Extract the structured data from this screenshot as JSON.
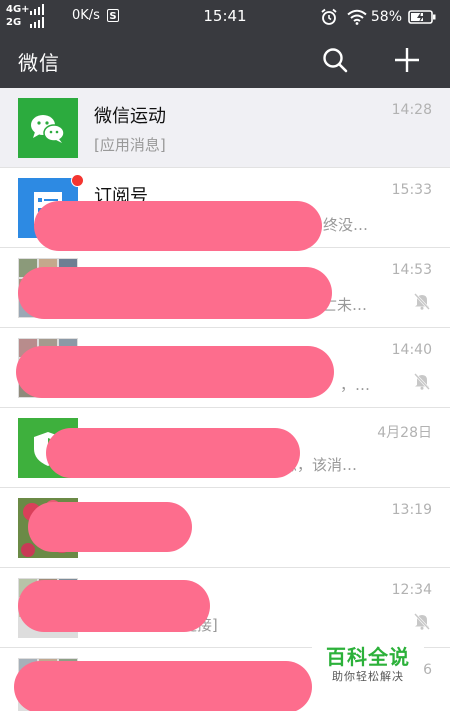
{
  "status_bar": {
    "network_top": "4G+",
    "network_bottom": "2G",
    "speed": "0K/s",
    "speed_badge": "S",
    "time": "15:41",
    "battery_percent": "58%"
  },
  "header": {
    "title": "微信",
    "search_icon": "search-icon",
    "add_icon": "plus-icon"
  },
  "chats": [
    {
      "name": "微信运动",
      "preview": "[应用消息]",
      "time": "14:28",
      "muted": false,
      "avatar": "wechat-sport-avatar",
      "accent": "#2cab3e"
    },
    {
      "name": "订阅号",
      "preview": "终没…",
      "time": "15:33",
      "muted": false,
      "unread_dot": true,
      "avatar": "subscription-avatar",
      "accent": "#2d8ae3"
    },
    {
      "name": "",
      "preview": "亡未…",
      "time": "14:53",
      "muted": true,
      "avatar": "group-photo-avatar"
    },
    {
      "name": "",
      "preview": "，…",
      "time": "14:40",
      "muted": true,
      "avatar": "group-photo-avatar"
    },
    {
      "name": "",
      "preview": "息，该消…",
      "time": "4月28日",
      "muted": false,
      "avatar": "shield-avatar",
      "accent": "#3eb03d"
    },
    {
      "name": "",
      "preview": "",
      "time": "13:19",
      "muted": false,
      "avatar": "flower-photo-avatar"
    },
    {
      "name": "",
      "preview": "[链接]",
      "time": "12:34",
      "muted": true,
      "avatar": "group-photo-avatar"
    },
    {
      "name": "",
      "preview": "",
      "time": "6",
      "muted": false,
      "avatar": "group-photo-avatar"
    }
  ],
  "watermark": {
    "main": "百科全说",
    "sub": "助你轻松解决"
  },
  "colors": {
    "header_bg": "#393a3f",
    "redaction": "#fd6d8d",
    "watermark_green": "#2cb13a"
  }
}
